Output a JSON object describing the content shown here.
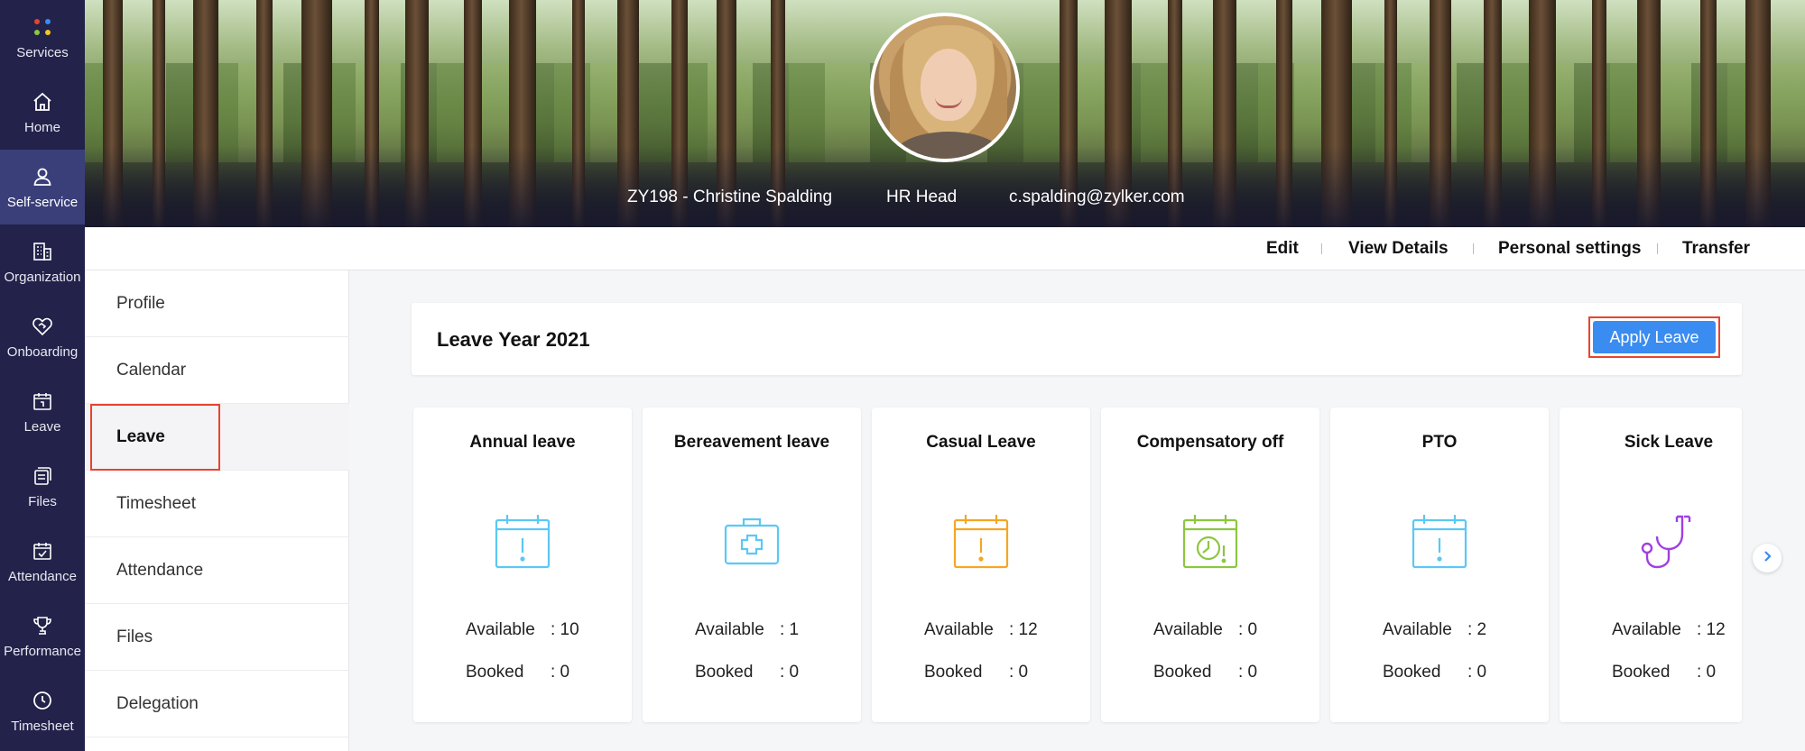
{
  "rail": {
    "items": [
      {
        "label": "Services",
        "icon": "services-dots-icon"
      },
      {
        "label": "Home",
        "icon": "home-icon"
      },
      {
        "label": "Self-service",
        "icon": "user-icon",
        "active": true
      },
      {
        "label": "Organization",
        "icon": "building-icon"
      },
      {
        "label": "Onboarding",
        "icon": "handshake-icon"
      },
      {
        "label": "Leave",
        "icon": "calendar-icon"
      },
      {
        "label": "Files",
        "icon": "files-icon"
      },
      {
        "label": "Attendance",
        "icon": "calendar-check-icon"
      },
      {
        "label": "Performance",
        "icon": "trophy-icon"
      },
      {
        "label": "Timesheet",
        "icon": "clock-icon"
      }
    ]
  },
  "profile": {
    "id_name": "ZY198 - Christine Spalding",
    "role": "HR Head",
    "email": "c.spalding@zylker.com"
  },
  "actions": {
    "edit": "Edit",
    "view_details": "View Details",
    "personal_settings": "Personal settings",
    "transfer": "Transfer"
  },
  "subnav": {
    "items": [
      "Profile",
      "Calendar",
      "Leave",
      "Timesheet",
      "Attendance",
      "Files",
      "Delegation"
    ],
    "active": "Leave"
  },
  "main": {
    "year_title": "Leave Year 2021",
    "apply_label": "Apply Leave",
    "available_label": "Available",
    "booked_label": "Booked",
    "leaves": [
      {
        "name": "Annual leave",
        "icon": "calendar-alert-icon",
        "color": "#5ac8f5",
        "available": ": 10",
        "booked": ": 0"
      },
      {
        "name": "Bereavement leave",
        "icon": "medical-kit-icon",
        "color": "#5ac8f5",
        "available": ": 1",
        "booked": ": 0"
      },
      {
        "name": "Casual Leave",
        "icon": "calendar-alert-icon",
        "color": "#f5a623",
        "available": ": 12",
        "booked": ": 0"
      },
      {
        "name": "Compensatory off",
        "icon": "calendar-clock-icon",
        "color": "#8dc63f",
        "available": ": 0",
        "booked": ": 0"
      },
      {
        "name": "PTO",
        "icon": "calendar-alert-icon",
        "color": "#5ac8f5",
        "available": ": 2",
        "booked": ": 0"
      },
      {
        "name": "Sick Leave",
        "icon": "stethoscope-icon",
        "color": "#a040e0",
        "available": ": 12",
        "booked": ": 0"
      }
    ]
  },
  "colors": {
    "rail_bg": "#22224a",
    "accent": "#3a8cf0",
    "highlight": "#e8432e"
  }
}
